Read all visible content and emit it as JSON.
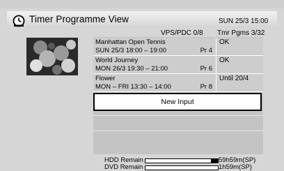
{
  "header": {
    "title": "Timer Programme View",
    "datetime": "SUN 25/3  15:00",
    "clock_icon": "clock-icon"
  },
  "subheader": {
    "vps_pdc": "VPS/PDC 0/8",
    "timer_programs": "Tmr Pgms  3/32"
  },
  "programmes": [
    {
      "name": "Manhattan Open Tennis",
      "schedule": "SUN 25/3    18:00 – 19:00",
      "channel": "Pr 4",
      "status": "OK"
    },
    {
      "name": "World Journey",
      "schedule": "MON 26/3    19:30 – 21:00",
      "channel": "Pr 6",
      "status": "OK"
    },
    {
      "name": "Flower",
      "schedule": "MON – FRI  13:30 – 14:00",
      "channel": "Pr 8",
      "status": "Until 20/4"
    }
  ],
  "new_input": {
    "label": "New Input"
  },
  "remaining": [
    {
      "label": "HDD Remain",
      "value": "59h59m(SP)",
      "level": 0.1
    },
    {
      "label": "DVD Remain",
      "value": "1h59m(SP)",
      "level": 0.0
    }
  ]
}
